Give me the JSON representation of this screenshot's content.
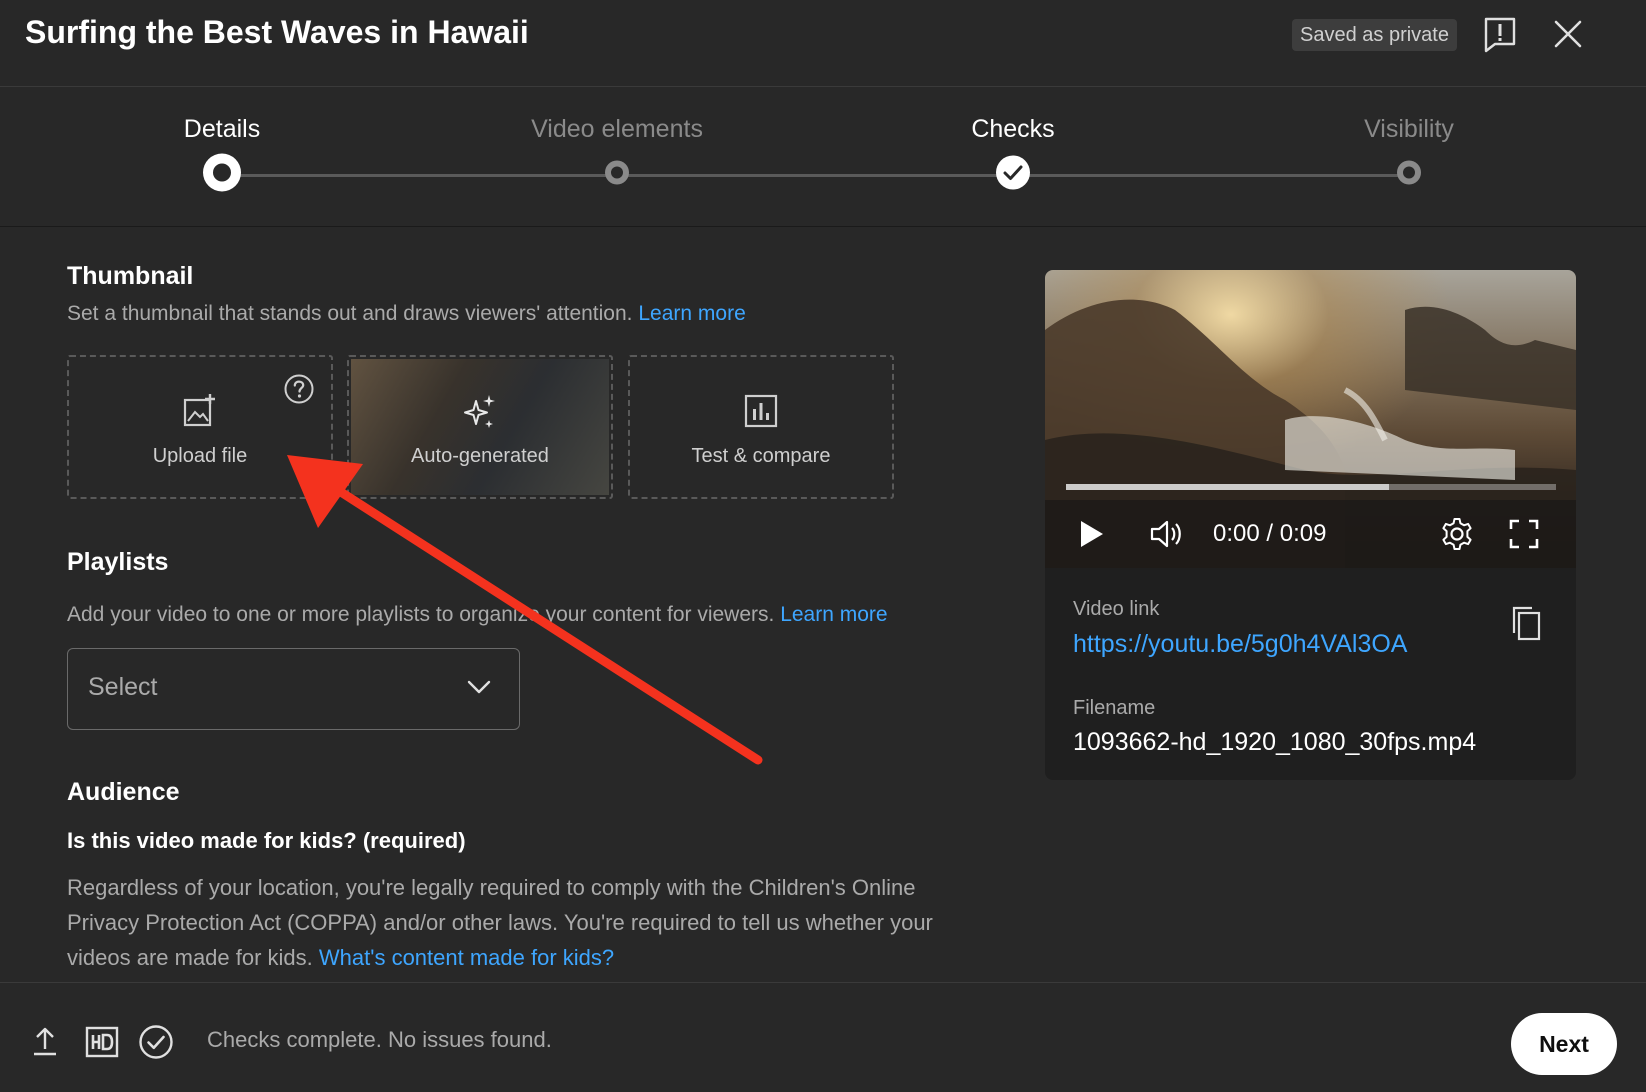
{
  "header": {
    "title": "Surfing the Best Waves in Hawaii",
    "saved_badge": "Saved as private"
  },
  "stepper": {
    "steps": [
      {
        "label": "Details",
        "state": "current"
      },
      {
        "label": "Video elements",
        "state": "upcoming"
      },
      {
        "label": "Checks",
        "state": "done"
      },
      {
        "label": "Visibility",
        "state": "upcoming"
      }
    ]
  },
  "thumbnail": {
    "title": "Thumbnail",
    "description": "Set a thumbnail that stands out and draws viewers' attention.",
    "learn_more": "Learn more",
    "options": [
      {
        "label": "Upload file",
        "icon": "image-add-icon"
      },
      {
        "label": "Auto-generated",
        "icon": "sparkle-icon"
      },
      {
        "label": "Test & compare",
        "icon": "bar-chart-icon"
      }
    ]
  },
  "playlists": {
    "title": "Playlists",
    "description": "Add your video to one or more playlists to organize your content for viewers.",
    "learn_more": "Learn more",
    "select_value": "Select"
  },
  "audience": {
    "title": "Audience",
    "question": "Is this video made for kids? (required)",
    "text": "Regardless of your location, you're legally required to comply with the Children's Online Privacy Protection Act (COPPA) and/or other laws. You're required to tell us whether your videos are made for kids.",
    "link": "What's content made for kids?"
  },
  "video": {
    "time": "0:00 / 0:09",
    "progress_fraction": 0.66,
    "link_label": "Video link",
    "link_url": "https://youtu.be/5g0h4VAl3OA",
    "filename_label": "Filename",
    "filename": "1093662-hd_1920_1080_30fps.mp4"
  },
  "footer": {
    "status": "Checks complete. No issues found.",
    "next_label": "Next"
  },
  "colors": {
    "background": "#282828",
    "link": "#3ea6ff",
    "annotation_arrow": "#f4321e"
  }
}
